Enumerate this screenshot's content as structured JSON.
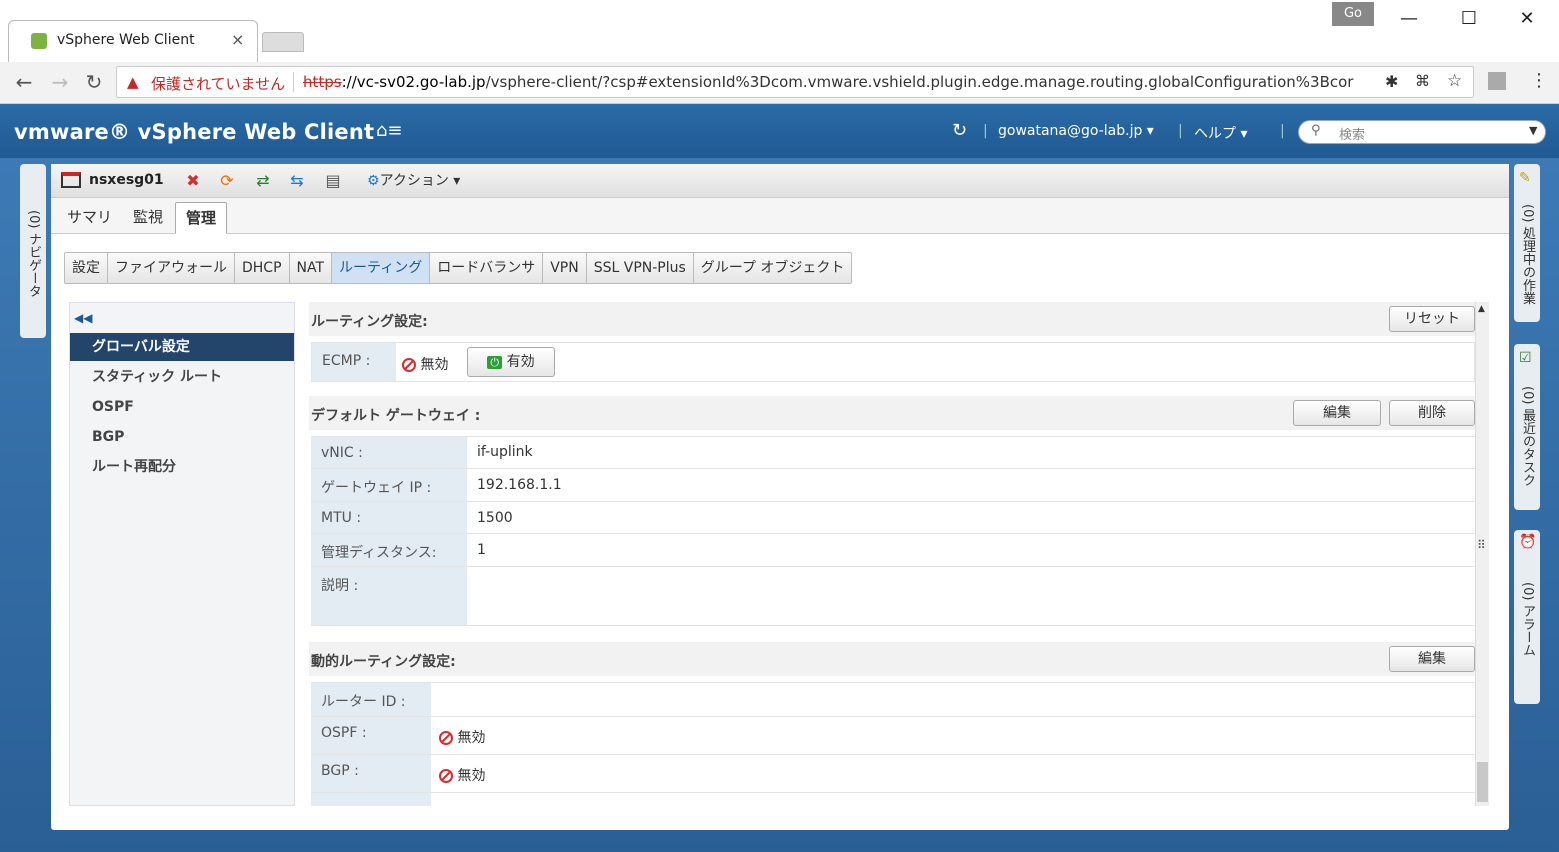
{
  "browser": {
    "tab_title": "vSphere Web Client",
    "go_label": "Go",
    "insecure_label": "保護されていません",
    "url_scheme": "https",
    "url_host": "://vc-sv02.go-lab.jp",
    "url_path": "/vsphere-client/?csp#extensionId%3Dcom.vmware.vshield.plugin.edge.manage.routing.globalConfiguration%3Bcor"
  },
  "header": {
    "logo": "vmware® vSphere Web Client",
    "user": "gowatana@go-lab.jp ▾",
    "help": "ヘルプ ▾",
    "search_placeholder": "検索"
  },
  "side": {
    "navigator": "(0) ナビゲータ",
    "tasks": "(0) 処理中の作業",
    "recent": "(0) 最近のタスク",
    "alarms": "(0) アラーム"
  },
  "object": {
    "name": "nsxesg01",
    "actions": "アクション ▾"
  },
  "subtabs": [
    "サマリ",
    "監視",
    "管理"
  ],
  "segtabs": [
    "設定",
    "ファイアウォール",
    "DHCP",
    "NAT",
    "ルーティング",
    "ロードバランサ",
    "VPN",
    "SSL VPN-Plus",
    "グループ オブジェクト"
  ],
  "leftnav": [
    "グローバル設定",
    "スタティック ルート",
    "OSPF",
    "BGP",
    "ルート再配分"
  ],
  "routing": {
    "title": "ルーティング設定:",
    "reset": "リセット",
    "ecmp_label": "ECMP :",
    "ecmp_state": "無効",
    "enable_btn": "有効"
  },
  "gateway": {
    "title": "デフォルト ゲートウェイ :",
    "edit": "編集",
    "delete": "削除",
    "rows": [
      {
        "label": "vNIC :",
        "value": "if-uplink"
      },
      {
        "label": "ゲートウェイ IP :",
        "value": "192.168.1.1"
      },
      {
        "label": "MTU :",
        "value": "1500"
      },
      {
        "label": "管理ディスタンス:",
        "value": "1"
      },
      {
        "label": "説明 :",
        "value": ""
      }
    ]
  },
  "dynamic": {
    "title": "動的ルーティング設定:",
    "edit": "編集",
    "router_id_label": "ルーター ID :",
    "router_id": "",
    "ospf_label": "OSPF :",
    "ospf_state": "無効",
    "bgp_label": "BGP :",
    "bgp_state": "無効"
  },
  "colors": {
    "header_blue": "#2b6ba6",
    "nav_selected": "#23456b",
    "label_bg": "#e3ecf3",
    "warn_red": "#c62828"
  }
}
